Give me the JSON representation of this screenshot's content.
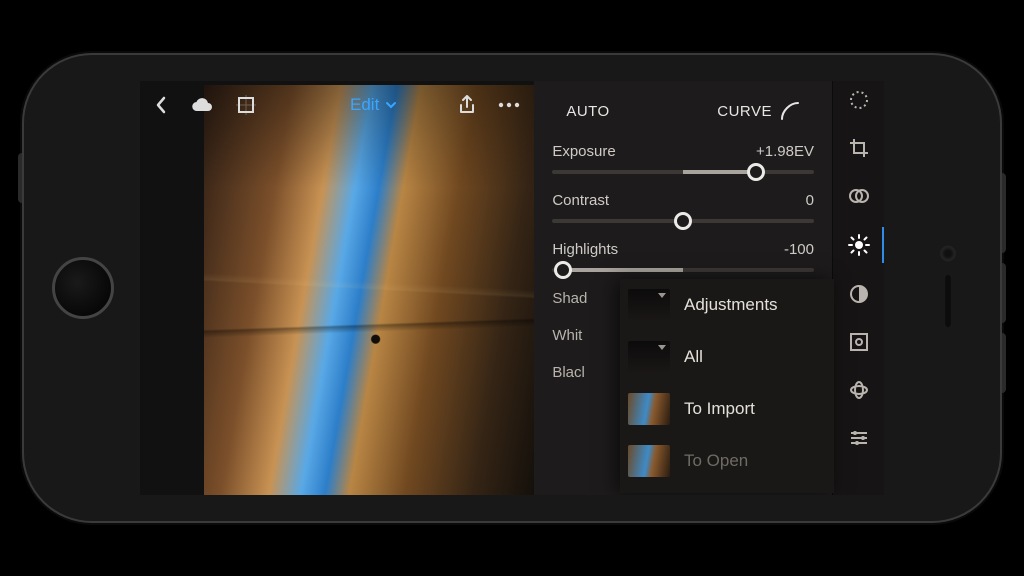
{
  "header": {
    "mode_label": "Edit"
  },
  "buttons": {
    "auto": "AUTO",
    "curve": "CURVE"
  },
  "sliders": {
    "exposure": {
      "label": "Exposure",
      "value_text": "+1.98EV",
      "pos": 0.78
    },
    "contrast": {
      "label": "Contrast",
      "value_text": "0",
      "pos": 0.5
    },
    "highlights": {
      "label": "Highlights",
      "value_text": "-100",
      "pos": 0.02
    },
    "shadows_trunc": "Shad",
    "whites_trunc": "Whit",
    "blacks_trunc": "Blacl"
  },
  "popup": {
    "items": [
      {
        "label": "Adjustments",
        "thumb": "dark",
        "dim": false
      },
      {
        "label": "All",
        "thumb": "dark",
        "dim": false
      },
      {
        "label": "To Import",
        "thumb": "photo",
        "dim": false
      },
      {
        "label": "To Open",
        "thumb": "photo",
        "dim": true
      }
    ]
  },
  "rail": {
    "items": [
      "dial-icon",
      "crop-icon",
      "profiles-icon",
      "light-icon",
      "color-icon",
      "optics-icon",
      "effects-icon",
      "presets-icon",
      "undo-icon"
    ],
    "active_index": 3
  }
}
